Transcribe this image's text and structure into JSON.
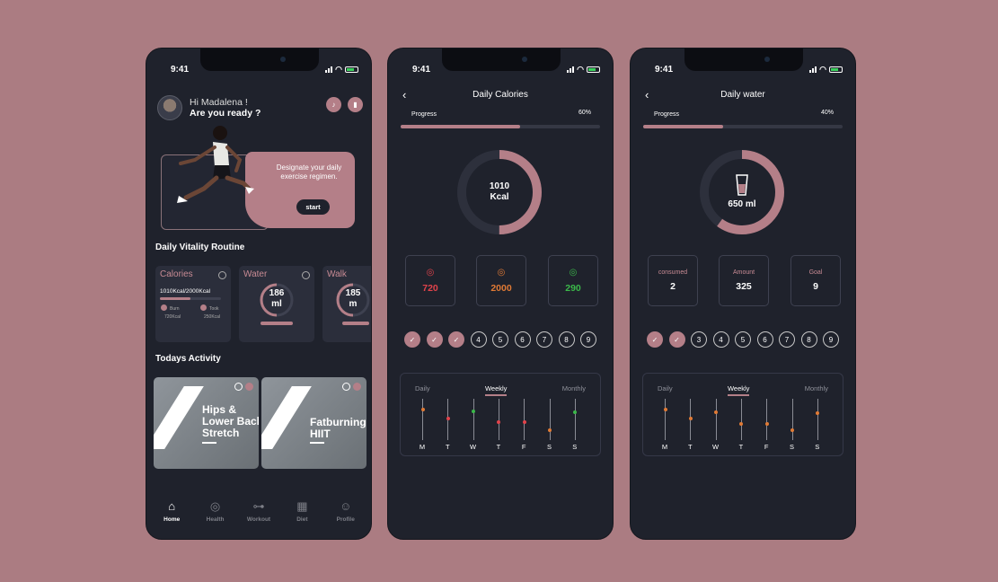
{
  "status": {
    "time": "9:41"
  },
  "home": {
    "greeting": "Hi Madalena !",
    "subtitle": "Are you ready ?",
    "hero_text": "Designate your daily exercise regimen.",
    "start_label": "start",
    "routine_title": "Daily Vitality Routine",
    "cards": {
      "calories": {
        "title": "Calories",
        "summary": "1010Kcal/2000Kcal",
        "burn_label": "Burn",
        "burn_value": "720Kcal",
        "took_label": "Took",
        "took_value": "250Kcal",
        "progress": 0.5
      },
      "water": {
        "title": "Water",
        "value": "186",
        "unit": "ml"
      },
      "walk": {
        "title": "Walk",
        "value": "185",
        "unit": "m"
      }
    },
    "activity_title": "Todays Activity",
    "activities": [
      {
        "title": "Hips &\nLower Back\nStretch"
      },
      {
        "title": "Fatburning\nHIIT"
      }
    ],
    "nav": [
      "Home",
      "Health",
      "Workout",
      "Diet",
      "Profile"
    ]
  },
  "calories": {
    "title": "Daily Calories",
    "progress_label": "Progress",
    "progress_value": "60%",
    "progress": 0.6,
    "ring_value": "1010",
    "ring_unit": "Kcal",
    "ring_fraction": 0.5,
    "stats": [
      {
        "value": "720",
        "color": "#e2434b",
        "icon": "target-icon"
      },
      {
        "value": "2000",
        "color": "#e07a35",
        "icon": "target-icon"
      },
      {
        "value": "290",
        "color": "#3bb84a",
        "icon": "target-icon"
      }
    ],
    "days": [
      "1",
      "2",
      "3",
      "4",
      "5",
      "6",
      "7",
      "8",
      "9"
    ],
    "done_days": 3,
    "tabs": [
      "Daily",
      "Weekly",
      "Monthly"
    ],
    "active_tab": "Weekly",
    "chart_labels": [
      "M",
      "T",
      "W",
      "T",
      "F",
      "S",
      "S"
    ],
    "chart_values": [
      0.25,
      0.47,
      0.3,
      0.57,
      0.57,
      0.77,
      0.33
    ],
    "chart_colors": [
      "#e07a35",
      "#e2434b",
      "#3bb84a",
      "#e2434b",
      "#e2434b",
      "#e07a35",
      "#3bb84a"
    ]
  },
  "water": {
    "title": "Daily water",
    "progress_label": "Progress",
    "progress_value": "40%",
    "progress": 0.4,
    "ring_value": "650 ml",
    "ring_fraction": 0.6,
    "stats": [
      {
        "label": "consumed",
        "value": "2"
      },
      {
        "label": "Amount",
        "value": "325"
      },
      {
        "label": "Goal",
        "value": "9"
      }
    ],
    "days": [
      "1",
      "2",
      "3",
      "4",
      "5",
      "6",
      "7",
      "8",
      "9"
    ],
    "done_days": 2,
    "tabs": [
      "Daily",
      "Weekly",
      "Monthly"
    ],
    "active_tab": "Weekly",
    "chart_labels": [
      "M",
      "T",
      "W",
      "T",
      "F",
      "S",
      "S"
    ],
    "chart_values": [
      0.25,
      0.47,
      0.32,
      0.6,
      0.6,
      0.77,
      0.35
    ],
    "chart_colors": [
      "#e07a35",
      "#e07a35",
      "#e07a35",
      "#e07a35",
      "#e07a35",
      "#e07a35",
      "#e07a35"
    ]
  }
}
